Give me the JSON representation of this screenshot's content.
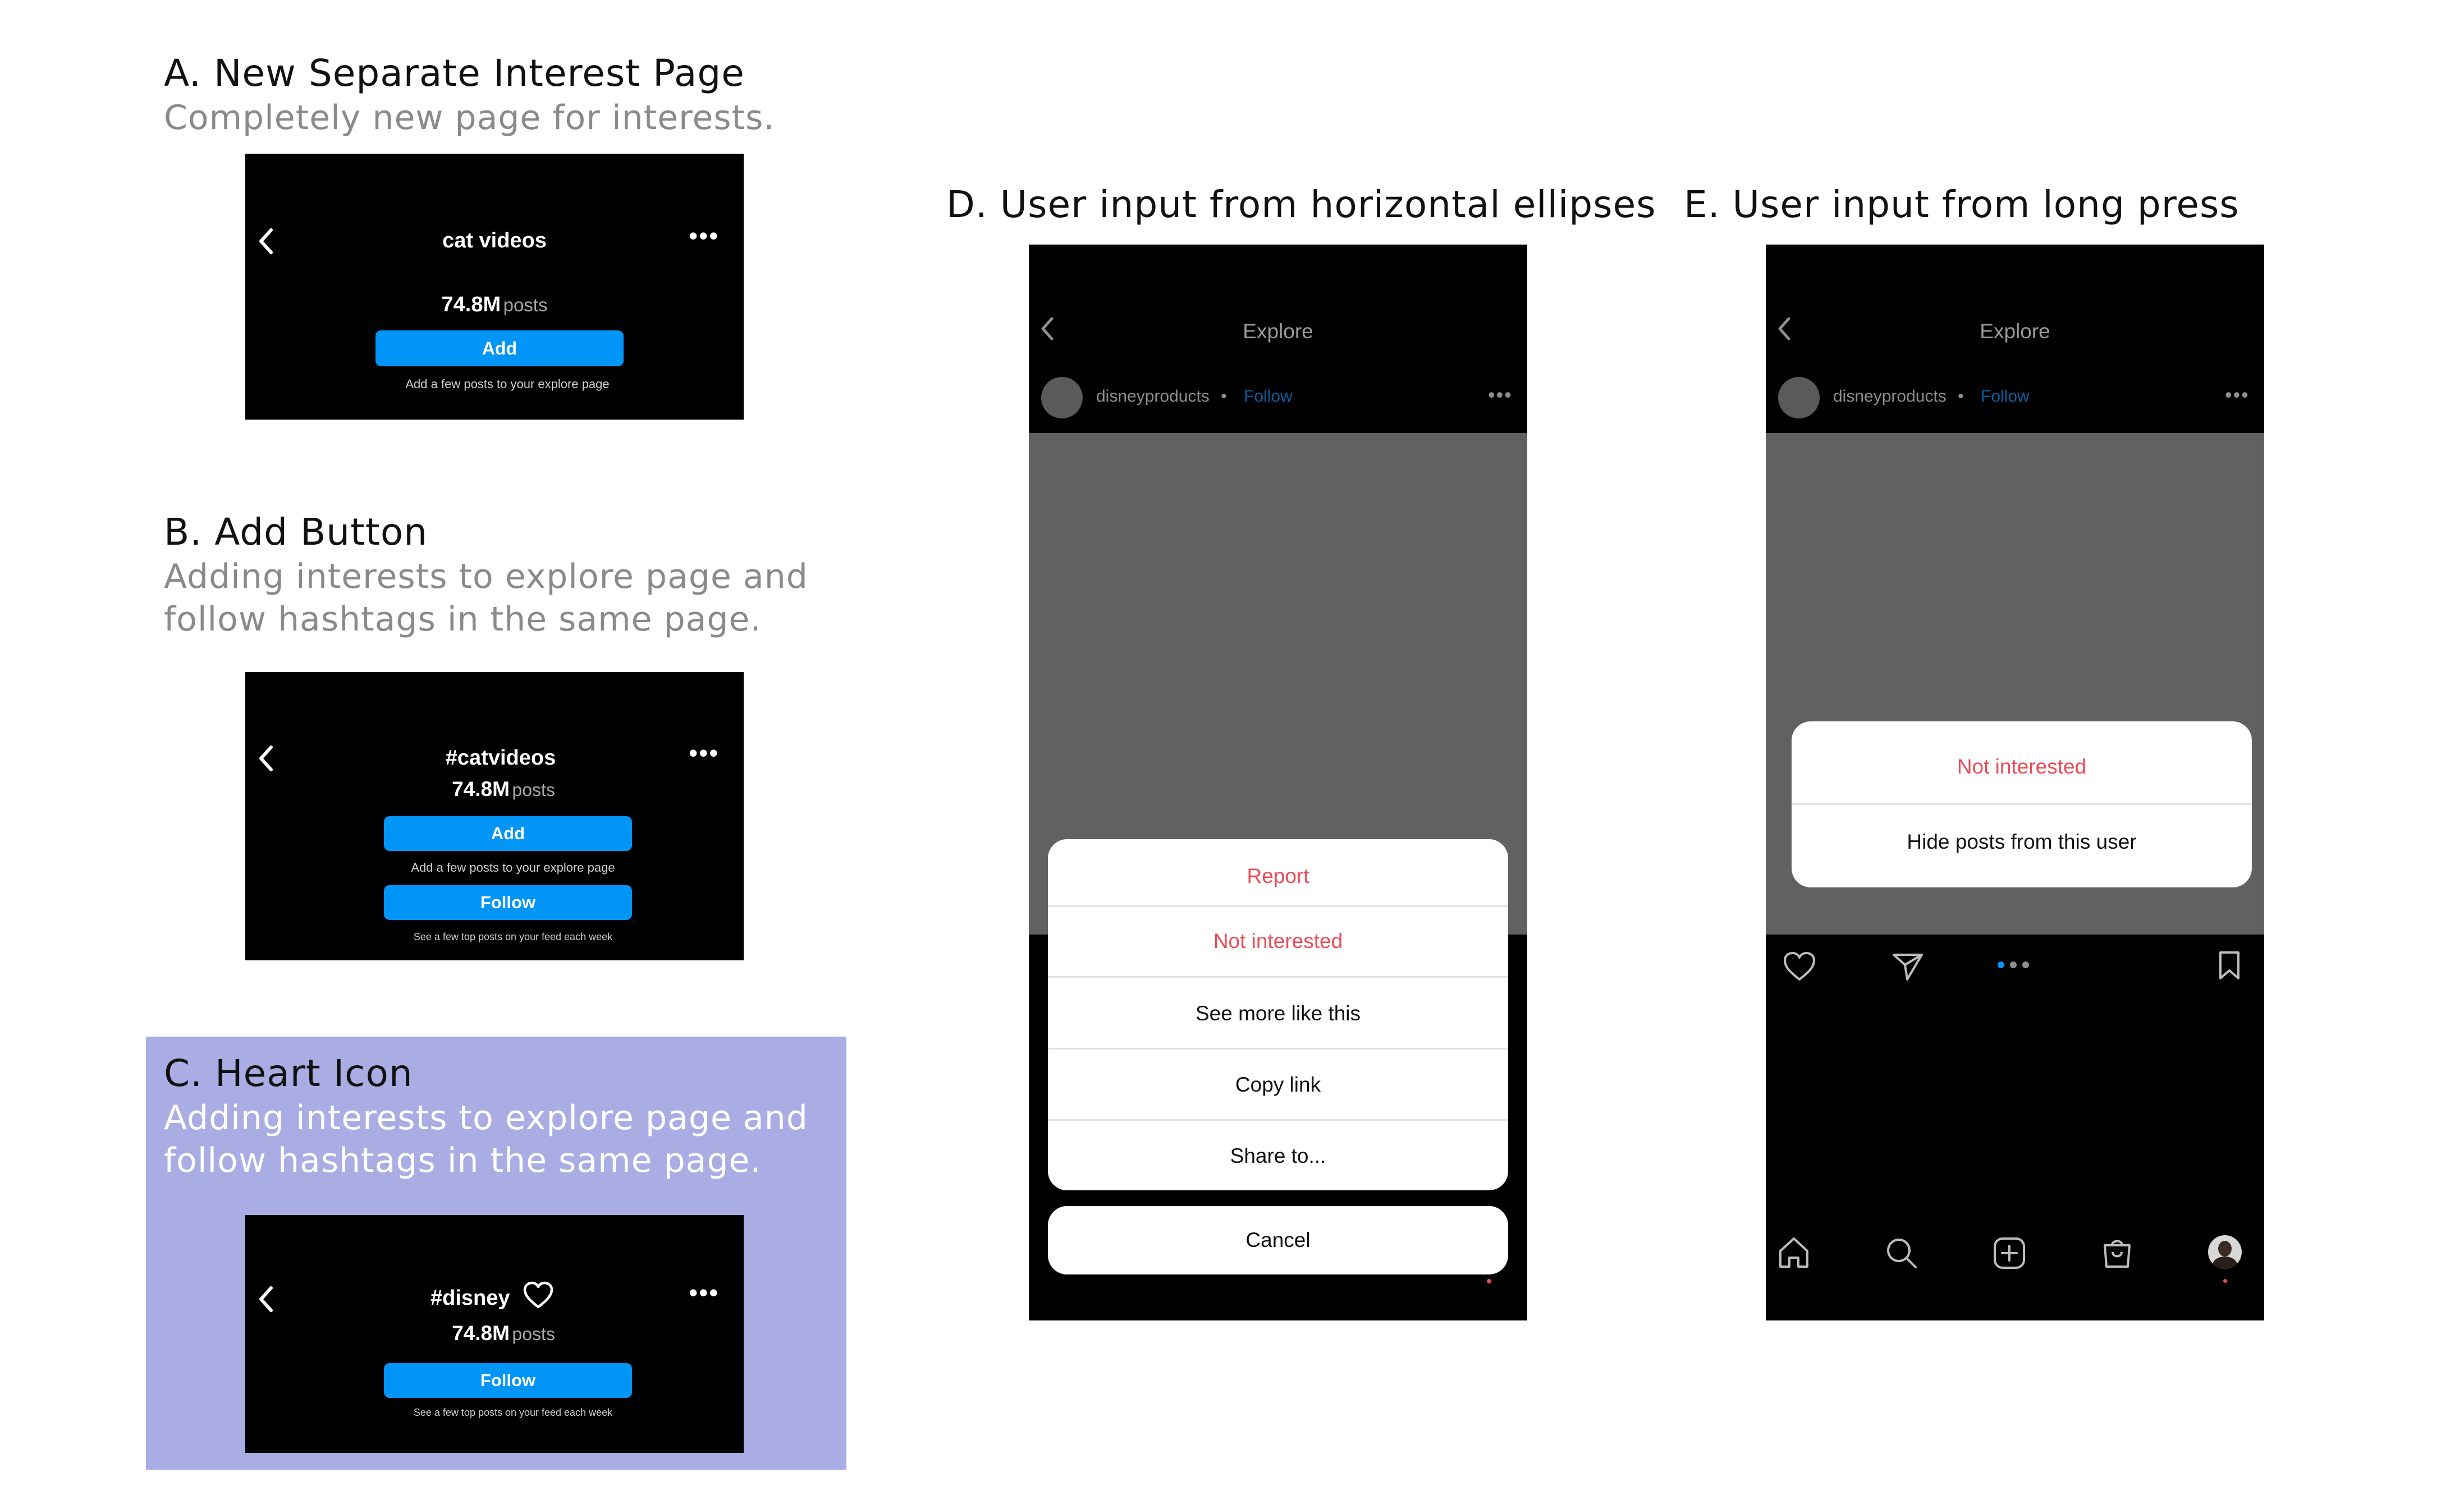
{
  "section_a": {
    "title": "A. New Separate Interest Page",
    "subtitle": "Completely new page for interests.",
    "screen": {
      "tag_title": "cat videos",
      "count": "74.8M",
      "count_unit": "posts",
      "add_label": "Add",
      "add_caption": "Add a few posts to your explore page"
    }
  },
  "section_b": {
    "title": "B. Add Button",
    "subtitle_line1": "Adding interests to explore page and",
    "subtitle_line2": "follow hashtags in the same page.",
    "screen": {
      "tag_title": "#catvideos",
      "count": "74.8M",
      "count_unit": "posts",
      "add_label": "Add",
      "add_caption": "Add a few posts to your explore page",
      "follow_label": "Follow",
      "follow_caption": "See a few top posts on your feed each week"
    }
  },
  "section_c": {
    "title": "C. Heart Icon",
    "subtitle_line1": "Adding interests to explore page and",
    "subtitle_line2": "follow hashtags in the same page.",
    "highlight_color": "#a9ade3",
    "screen": {
      "tag_title": "#disney",
      "count": "74.8M",
      "count_unit": "posts",
      "follow_label": "Follow",
      "follow_caption": "See a few top posts on your feed each week"
    }
  },
  "section_d": {
    "title": "D. User input from horizontal ellipses",
    "screen": {
      "header": "Explore",
      "username": "disneyproducts",
      "separator": "•",
      "follow": "Follow",
      "menu": [
        "Report",
        "Not interested",
        "See more like this",
        "Copy link",
        "Share to..."
      ],
      "cancel": "Cancel"
    }
  },
  "section_e": {
    "title": "E. User input from long press",
    "screen": {
      "header": "Explore",
      "username": "disneyproducts",
      "separator": "•",
      "follow": "Follow",
      "menu": [
        "Not interested",
        "Hide posts from this user"
      ]
    }
  },
  "colors": {
    "accent_blue": "#0095f6",
    "alert_red": "#ed4956",
    "media_gray": "#616161"
  }
}
